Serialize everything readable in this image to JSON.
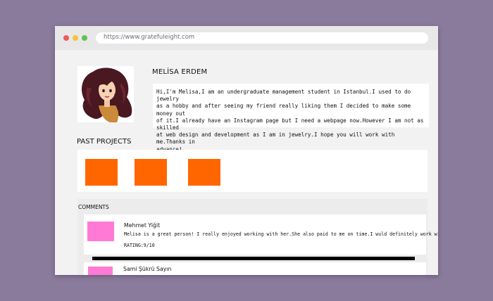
{
  "browser": {
    "url": "https://www.gratefuleight.com"
  },
  "profile": {
    "name": "MELİSA ERDEM",
    "bio_lines": [
      "Hi,I'm Melisa,I am an undergraduate management student in Istanbul.I used to do jewelry",
      "as a hobby and after seeing my friend really liking them I decided to make some money out",
      "of it.I already have an Instagram page but I need a webpage now.However I am not as skilled",
      "at web design and development as I am in jewelry.I hope you will work with me.Thanks in",
      "advance!"
    ]
  },
  "past_projects": {
    "title": "PAST PROJECTS",
    "color": "#ff6600"
  },
  "comments": {
    "title": "COMMENTS",
    "items": [
      {
        "author": "Mehmet Yiğit",
        "text": "Melisa is a great person! I really enjoyed working with her.She also paid to me on time.I wuld definitely work with her.",
        "rating": "RATING:9/10",
        "avatar_color": "#ff7ad4"
      },
      {
        "author": "Sami Şükrü Sayın",
        "avatar_color": "#ff7ad4"
      }
    ]
  }
}
